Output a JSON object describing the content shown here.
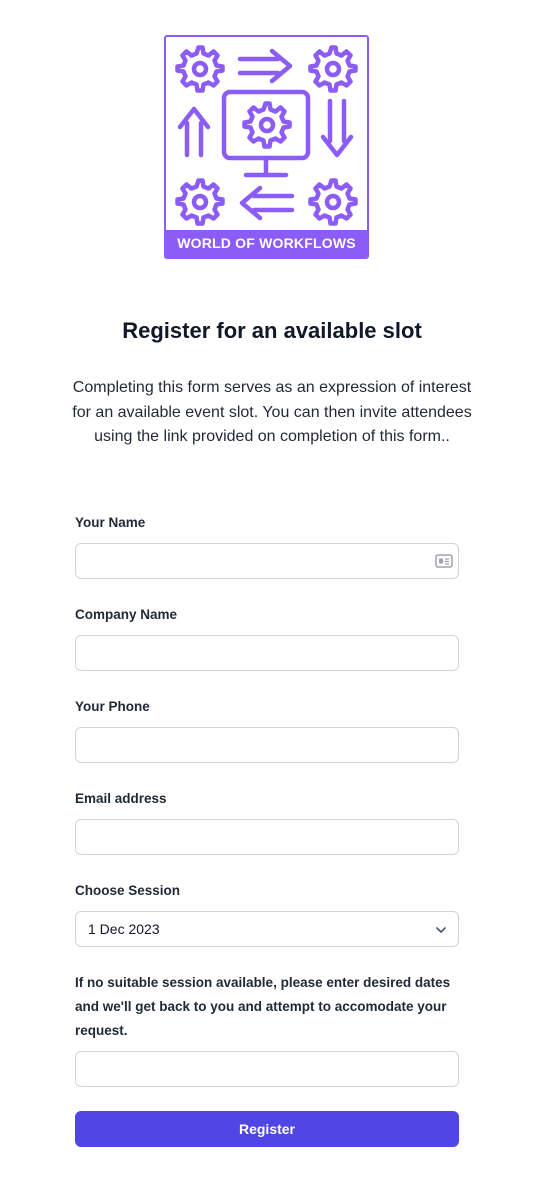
{
  "brand": {
    "logo_text": "WORLD OF WORKFLOWS",
    "accent_color": "#8b5cf6",
    "icon_names": [
      "gear-icon",
      "arrow-right-icon",
      "arrow-up-icon",
      "monitor-gear-icon",
      "arrow-down-icon",
      "arrow-left-icon"
    ]
  },
  "page": {
    "title": "Register for an available slot",
    "intro": "Completing this form serves as an expression of interest for an available event slot. You can then invite attendees using the link provided on completion of this form.."
  },
  "form": {
    "name_label": "Your Name",
    "name_value": "",
    "company_label": "Company Name",
    "company_value": "",
    "phone_label": "Your Phone",
    "phone_value": "",
    "email_label": "Email address",
    "email_value": "",
    "session_label": "Choose Session",
    "session_value": "1 Dec 2023",
    "dates_note": "If no suitable session available, please enter desired dates and we'll get back to you and attempt to accomodate your request.",
    "dates_value": "",
    "register_label": "Register",
    "button_color": "#4f46e5"
  }
}
